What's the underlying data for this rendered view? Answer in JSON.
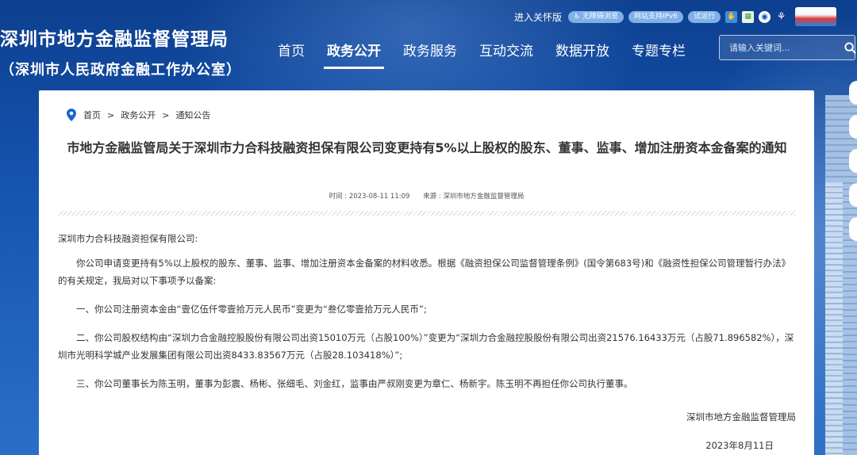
{
  "site": {
    "title": "深圳市地方金融监督管理局",
    "subtitle": "（深圳市人民政府金融工作办公室）"
  },
  "top_bar": {
    "care_version": "进入关怀版",
    "accessibility": "无障碍浏览",
    "ipv6": "网站支持IPv6",
    "trial": "试运行",
    "icons": [
      "hand-icon",
      "qr-icon",
      "weibo-icon",
      "share-icon",
      "emblem-logo"
    ]
  },
  "nav": {
    "items": [
      "首页",
      "政务公开",
      "政务服务",
      "互动交流",
      "数据开放",
      "专题专栏"
    ],
    "active": "政务公开"
  },
  "search": {
    "placeholder": "请输入关键词..."
  },
  "breadcrumb": {
    "items": [
      "首页",
      "政务公开",
      "通知公告"
    ],
    "separator": ">"
  },
  "article": {
    "title": "市地方金融监管局关于深圳市力合科技融资担保有限公司变更持有5%以上股权的股东、董事、监事、增加注册资本金备案的通知",
    "time": "时间 : 2023-08-11 11:09",
    "source": "来源 : 深圳市地方金融监督管理局",
    "paragraphs": [
      "深圳市力合科技融资担保有限公司:",
      "你公司申请变更持有5%以上股权的股东、董事、监事、增加注册资本金备案的材料收悉。根据《融资担保公司监督管理条例》(国令第683号)和《融资性担保公司管理暂行办法》的有关规定，我局对以下事项予以备案:",
      "一、你公司注册资本金由“壹亿伍仟零壹拾万元人民币”变更为“叁亿零壹拾万元人民币”;",
      "二、你公司股权结构由“深圳力合金融控股股份有限公司出资15010万元（占股100%）”变更为“深圳力合金融控股股份有限公司出资21576.16433万元（占股71.896582%），深圳市光明科学城产业发展集团有限公司出资8433.83567万元（占股28.103418%）”;",
      "三、你公司董事长为陈玉明，董事为彭震、杨彬、张细毛、刘金红，监事由严叔刚变更为章仁、杨新宇。陈玉明不再担任你公司执行董事。"
    ],
    "signature": "深圳市地方金融监督管理局",
    "date": "2023年8月11日"
  },
  "colors": {
    "header_bg": "#1656b3",
    "text": "#333333"
  }
}
